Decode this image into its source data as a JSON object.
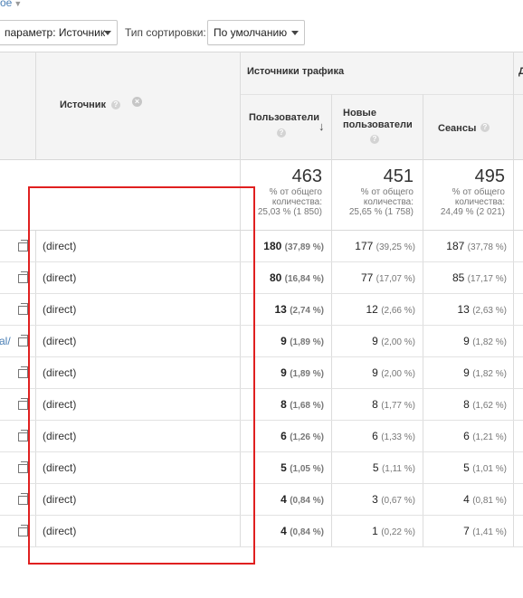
{
  "top_link": {
    "text": "ое"
  },
  "toolbar": {
    "secondary_dimension": "параметр: Источник",
    "sort_type_label": "Тип сортировки:",
    "sort_type_value": "По умолчанию"
  },
  "table": {
    "header": {
      "group_label": "Источники трафика",
      "group_label_2": "Д",
      "source": "Источник",
      "users": "Пользователи",
      "new_users": "Новые пользователи",
      "new_users_line1": "Новые",
      "new_users_line2": "пользователи",
      "sessions": "Сеансы",
      "help_glyph": "?",
      "remove_glyph": "×",
      "sort_glyph": "↓"
    },
    "totals": {
      "users": {
        "value": "463",
        "l1": "% от общего",
        "l2": "количества:",
        "l3": "25,03 % (1 850)"
      },
      "new_users": {
        "value": "451",
        "l1": "% от общего",
        "l2": "количества:",
        "l3": "25,65 % (1 758)"
      },
      "sessions": {
        "value": "495",
        "l1": "% от общего",
        "l2": "количества:",
        "l3": "24,49 % (2 021)"
      }
    },
    "rows": [
      {
        "left": "",
        "source": "(direct)",
        "users": "180",
        "users_pct": "(37,89 %)",
        "new_users": "177",
        "new_users_pct": "(39,25 %)",
        "sessions": "187",
        "sessions_pct": "(37,78 %)"
      },
      {
        "left": "",
        "source": "(direct)",
        "users": "80",
        "users_pct": "(16,84 %)",
        "new_users": "77",
        "new_users_pct": "(17,07 %)",
        "sessions": "85",
        "sessions_pct": "(17,17 %)"
      },
      {
        "left": "",
        "source": "(direct)",
        "users": "13",
        "users_pct": "(2,74 %)",
        "new_users": "12",
        "new_users_pct": "(2,66 %)",
        "sessions": "13",
        "sessions_pct": "(2,63 %)"
      },
      {
        "left": "al/",
        "source": "(direct)",
        "users": "9",
        "users_pct": "(1,89 %)",
        "new_users": "9",
        "new_users_pct": "(2,00 %)",
        "sessions": "9",
        "sessions_pct": "(1,82 %)"
      },
      {
        "left": "",
        "source": "(direct)",
        "users": "9",
        "users_pct": "(1,89 %)",
        "new_users": "9",
        "new_users_pct": "(2,00 %)",
        "sessions": "9",
        "sessions_pct": "(1,82 %)"
      },
      {
        "left": "",
        "source": "(direct)",
        "users": "8",
        "users_pct": "(1,68 %)",
        "new_users": "8",
        "new_users_pct": "(1,77 %)",
        "sessions": "8",
        "sessions_pct": "(1,62 %)"
      },
      {
        "left": "",
        "source": "(direct)",
        "users": "6",
        "users_pct": "(1,26 %)",
        "new_users": "6",
        "new_users_pct": "(1,33 %)",
        "sessions": "6",
        "sessions_pct": "(1,21 %)"
      },
      {
        "left": "",
        "source": "(direct)",
        "users": "5",
        "users_pct": "(1,05 %)",
        "new_users": "5",
        "new_users_pct": "(1,11 %)",
        "sessions": "5",
        "sessions_pct": "(1,01 %)"
      },
      {
        "left": "",
        "source": "(direct)",
        "users": "4",
        "users_pct": "(0,84 %)",
        "new_users": "3",
        "new_users_pct": "(0,67 %)",
        "sessions": "4",
        "sessions_pct": "(0,81 %)"
      },
      {
        "left": "",
        "source": "(direct)",
        "users": "4",
        "users_pct": "(0,84 %)",
        "new_users": "1",
        "new_users_pct": "(0,22 %)",
        "sessions": "7",
        "sessions_pct": "(1,41 %)"
      }
    ]
  },
  "colors": {
    "highlight": "#e02020",
    "link": "#4a7fb5",
    "header_bg": "#f4f4f4"
  },
  "icons": {
    "open_row": "open-in-new-icon",
    "help": "help-icon",
    "remove": "remove-dimension-icon",
    "sort": "sort-desc-icon"
  }
}
